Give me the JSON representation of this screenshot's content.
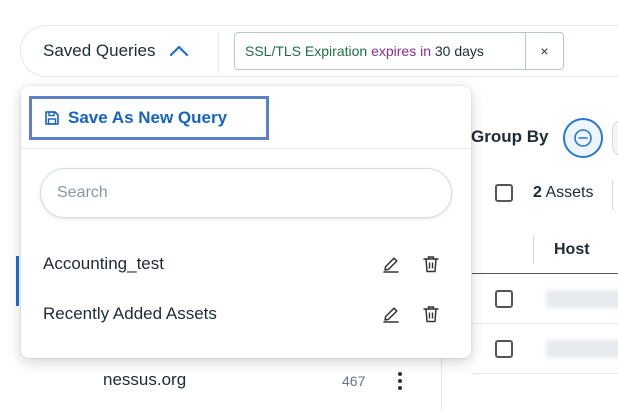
{
  "toolbar": {
    "saved_queries_label": "Saved Queries",
    "filter_chip": {
      "field": "SSL/TLS Expiration",
      "operator": "expires in",
      "value": "30 days",
      "close_glyph": "×"
    }
  },
  "dropdown": {
    "save_new_label": "Save As New Query",
    "search_placeholder": "Search",
    "queries": [
      {
        "label": "Accounting_test"
      },
      {
        "label": "Recently Added Assets"
      }
    ]
  },
  "background": {
    "group_by_label": "Group By",
    "assets_count": "2",
    "assets_word": " Assets",
    "host_column": "Host",
    "list_row": {
      "label": "nessus.org",
      "count": "467"
    }
  },
  "colors": {
    "accent": "#1662c4",
    "highlight_border": "#5b82c6",
    "chip_field": "#1f6f4a",
    "chip_operator": "#8a2b94"
  }
}
